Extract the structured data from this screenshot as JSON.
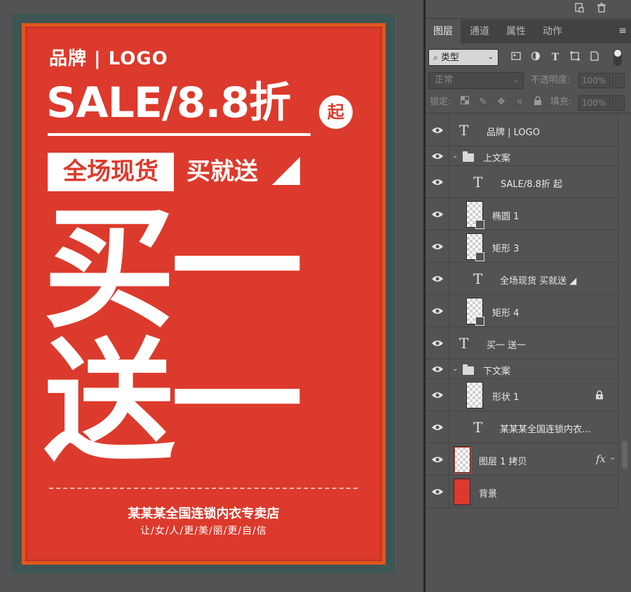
{
  "poster": {
    "brand": "品牌 | LOGO",
    "sale": "SALE/8.8折",
    "qi": "起",
    "whole_store": "全场现货",
    "buy_gift": "买就送",
    "big_line1": "买一",
    "big_line2": "送一",
    "store_name": "某某某全国连锁内衣专卖店",
    "slogan": "让/女/人/更/美/丽/更/自/信",
    "colors": {
      "frame": "#3d5555",
      "orange_border": "#e0571d",
      "background": "#dc3a2c"
    }
  },
  "panel": {
    "tabs": [
      {
        "label": "图层",
        "active": true
      },
      {
        "label": "通道",
        "active": false
      },
      {
        "label": "属性",
        "active": false
      },
      {
        "label": "动作",
        "active": false
      }
    ],
    "filter_kind": "类型",
    "blend_mode": "正常",
    "opacity_label": "不透明度:",
    "opacity_value": "100%",
    "lock_label": "锁定:",
    "fill_label": "填充:",
    "fill_value": "100%"
  },
  "layers": [
    {
      "name": "品牌 | LOGO",
      "type": "text"
    },
    {
      "name": "上文案",
      "type": "group"
    },
    {
      "name": "SALE/8.8折 起",
      "type": "text"
    },
    {
      "name": "椭圆 1",
      "type": "shape"
    },
    {
      "name": "矩形 3",
      "type": "shape"
    },
    {
      "name": "全场现货  买就送 ◢",
      "type": "text"
    },
    {
      "name": "矩形 4",
      "type": "shape"
    },
    {
      "name": "买一 送一",
      "type": "text"
    },
    {
      "name": "下文案",
      "type": "group"
    },
    {
      "name": "形状 1",
      "type": "shape-locked"
    },
    {
      "name": "某某某全国连锁内衣...",
      "type": "text"
    },
    {
      "name": "图层 1 拷贝",
      "type": "pixel-fx",
      "fx": "fx"
    },
    {
      "name": "背景",
      "type": "background"
    }
  ]
}
